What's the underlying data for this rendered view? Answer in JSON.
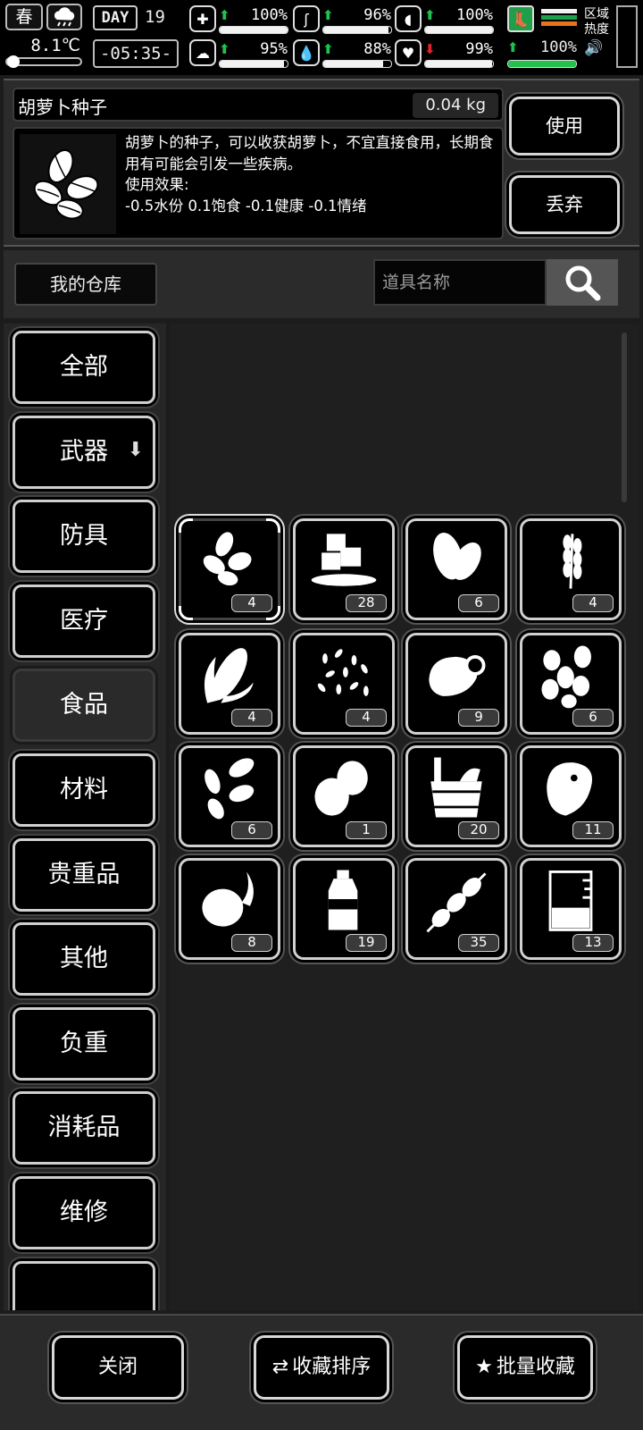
{
  "status": {
    "season": "春",
    "temperature": "8.1℃",
    "day_label": "DAY",
    "day_number": "19",
    "clock": "-05:35-",
    "stats": [
      {
        "name": "health",
        "icon": "medkit-icon",
        "trend": "up",
        "pct_text": "100%",
        "level": 1.0
      },
      {
        "name": "hunger",
        "icon": "stomach-icon",
        "trend": "up",
        "pct_text": "96%",
        "level": 0.96
      },
      {
        "name": "medicine",
        "icon": "pill-icon",
        "trend": "up",
        "pct_text": "100%",
        "level": 1.0
      },
      {
        "name": "brain",
        "icon": "brain-icon",
        "trend": "up",
        "pct_text": "95%",
        "level": 0.95
      },
      {
        "name": "water",
        "icon": "water-drop-icon",
        "trend": "up",
        "pct_text": "88%",
        "level": 0.88
      },
      {
        "name": "mood",
        "icon": "heart-icon",
        "trend": "down",
        "pct_text": "99%",
        "level": 0.99
      }
    ],
    "stamina": {
      "icon": "boot-icon",
      "pct_text": "100%",
      "level": 1.0,
      "flag_colors": [
        "#f2f2f2",
        "#1ea04a",
        "#e8731c"
      ]
    },
    "zone_heat_label": "区域热度"
  },
  "item": {
    "name": "胡萝卜种子",
    "weight": "0.04 kg",
    "description": "胡萝卜的种子，可以收获胡萝卜，不宜直接食用，长期食用有可能会引发一些疾病。",
    "effect_title": "使用效果:",
    "effect_values": "-0.5水份 0.1饱食 -0.1健康 -0.1情绪",
    "use_label": "使用",
    "discard_label": "丢弃"
  },
  "warehouse": {
    "title": "我的仓库",
    "search_placeholder": "道具名称"
  },
  "categories": [
    {
      "label": "全部",
      "active": false
    },
    {
      "label": "武器",
      "active": false,
      "has_dropdown": true
    },
    {
      "label": "防具",
      "active": false
    },
    {
      "label": "医疗",
      "active": false
    },
    {
      "label": "食品",
      "active": true
    },
    {
      "label": "材料",
      "active": false
    },
    {
      "label": "贵重品",
      "active": false
    },
    {
      "label": "其他",
      "active": false
    },
    {
      "label": "负重",
      "active": false
    },
    {
      "label": "消耗品",
      "active": false
    },
    {
      "label": "维修",
      "active": false
    }
  ],
  "items": [
    {
      "icon": "carrot-seeds-icon",
      "count": "4",
      "selected": true
    },
    {
      "icon": "sugar-cubes-icon",
      "count": "28"
    },
    {
      "icon": "beans-icon",
      "count": "6"
    },
    {
      "icon": "wheat-icon",
      "count": "4"
    },
    {
      "icon": "corn-icon",
      "count": "4"
    },
    {
      "icon": "rice-grains-icon",
      "count": "4"
    },
    {
      "icon": "meat-bone-icon",
      "count": "9"
    },
    {
      "icon": "peanuts-icon",
      "count": "6"
    },
    {
      "icon": "pumpkin-seeds-icon",
      "count": "6"
    },
    {
      "icon": "potatoes-icon",
      "count": "1"
    },
    {
      "icon": "bucket-icon",
      "count": "20"
    },
    {
      "icon": "steak-icon",
      "count": "11"
    },
    {
      "icon": "onion-icon",
      "count": "8"
    },
    {
      "icon": "water-bottle-icon",
      "count": "19"
    },
    {
      "icon": "skewer-icon",
      "count": "35"
    },
    {
      "icon": "beaker-icon",
      "count": "13"
    }
  ],
  "bottom": {
    "close_label": "关闭",
    "sort_label": "收藏排序",
    "batch_label": "批量收藏"
  },
  "colors": {
    "up_arrow": "#1ec24e",
    "down_arrow": "#e0242a",
    "stamina_green": "#23c24c"
  }
}
